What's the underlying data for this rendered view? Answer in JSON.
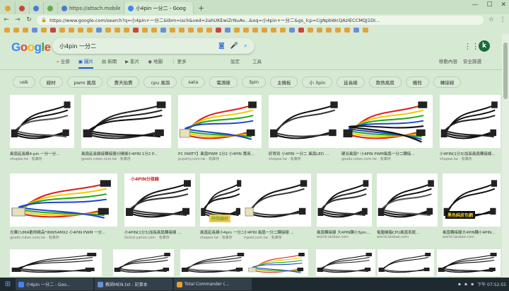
{
  "browser": {
    "tabs": [
      {
        "label": "",
        "color": "#e2a23a"
      },
      {
        "label": "",
        "color": "#c9453a"
      },
      {
        "label": "",
        "color": "#4a7bd0"
      },
      {
        "label": "",
        "color": "#6aa84f"
      },
      {
        "label": "https://attach.mobile",
        "color": "#4a7bd0"
      },
      {
        "label": "小4pin 一分二 - Goog",
        "color": "#4285f4",
        "active": true
      }
    ],
    "url": "https://www.google.com/search?q=小4pin+一分二&tbm=isch&ved=2ahUKEwiZrNuAv...&oq=小4pin+一分二&gs_lcp=CgNpbWcQAzIECCMQJ1DI...",
    "bookmark_count": 40
  },
  "google": {
    "logo": "Google",
    "query": "小4pin 一分二",
    "avatar_letter": "k",
    "tabs": [
      "全部",
      "圖片",
      "新聞",
      "影片",
      "地圖",
      "更多"
    ],
    "tools": [
      "設定",
      "工具"
    ],
    "right": [
      "移動內容",
      "安全篩選"
    ]
  },
  "chips": [
    "usb",
    "線材",
    "pwm 風扇",
    "賣天拍賣",
    "cpu 風扇",
    "sata",
    "電源線",
    "3pin",
    "主機板",
    "小 3pin",
    "延長線",
    "散熱風扇",
    "機殼",
    "轉接線"
  ],
  "results": [
    {
      "title": "風扇延長線4-pin 一分一分...",
      "src": "shopee.tw · 有庫存",
      "style": "fan"
    },
    {
      "title": "風扇延長線接轉接器分開線小4PIN 1分2 P...",
      "src": "goods.ruten.com.tw · 有庫存",
      "style": "ycable"
    },
    {
      "title": "PC PARTY】風扇PWM 1分2 小4PIN 專用...",
      "src": "pcparty.com.tw · 有庫存",
      "style": "rainbow"
    },
    {
      "title": "好貨到 小4PIN 一分二 風扇LED ...",
      "src": "shopee.tw · 有庫存",
      "style": "labelled"
    },
    {
      "title": "硬派風扇* 小4PIN PWM風扇一分二轉接...",
      "src": "goods.ruten.com.tw · 有庫存",
      "style": "colorful"
    },
    {
      "title": "小4PIN(1分3)加長風扇轉接線...",
      "src": "shopee.tw · 有庫存",
      "style": "fanbig"
    },
    {
      "title": "光華CUMA散熱精品*INWS4MX2 小4PIN PWM 一分...",
      "src": "goods.ruten.com.tw · 有庫存",
      "style": "rainbow2"
    },
    {
      "title": "小4PIN(1分3)加長風扇轉接線 ...",
      "src": "tw.bid.yahoo.com · 有庫存",
      "style": "split"
    },
    {
      "title": "風扇延長線小4pin 一分二 ...",
      "src": "shopee.tw · 有庫存",
      "style": "ycable"
    },
    {
      "title": "小4PIN 風扇一分二轉接線 ...",
      "src": "inpad.com.tw · 有庫存",
      "style": "connector"
    },
    {
      "title": "風扇轉接線 大4PIN轉小3pin...",
      "src": "world.taobao.com",
      "style": "split"
    },
    {
      "title": "電腦機箱CPU風扇系統...",
      "src": "world.taobao.com",
      "style": "fan"
    },
    {
      "title": "風扇轉接線大4PIN轉小4PIN...",
      "src": "world.taobao.com",
      "style": "net"
    },
    {
      "title": "",
      "src": "",
      "style": "cable"
    },
    {
      "title": "",
      "src": "",
      "style": "ycable"
    },
    {
      "title": "",
      "src": "",
      "style": "fan"
    },
    {
      "title": "",
      "src": "",
      "style": "rainbow"
    },
    {
      "title": "",
      "src": "",
      "style": "split"
    },
    {
      "title": "",
      "src": "",
      "style": "net"
    },
    {
      "title": "",
      "src": "",
      "style": "cable"
    }
  ],
  "overlays": {
    "yahoo": "小4PIN分接線",
    "shopee": "特殊線材",
    "black": "黑色純皮包網"
  },
  "taskbar": {
    "items": [
      {
        "label": "小4pin 一分二 - Goo...",
        "color": "#4285f4"
      },
      {
        "label": "教師MEN.txt - 記事本",
        "color": "#6b8fd4"
      },
      {
        "label": "Total Commander (...",
        "color": "#e2a23a"
      }
    ],
    "clock": "下午 07:52:55"
  }
}
